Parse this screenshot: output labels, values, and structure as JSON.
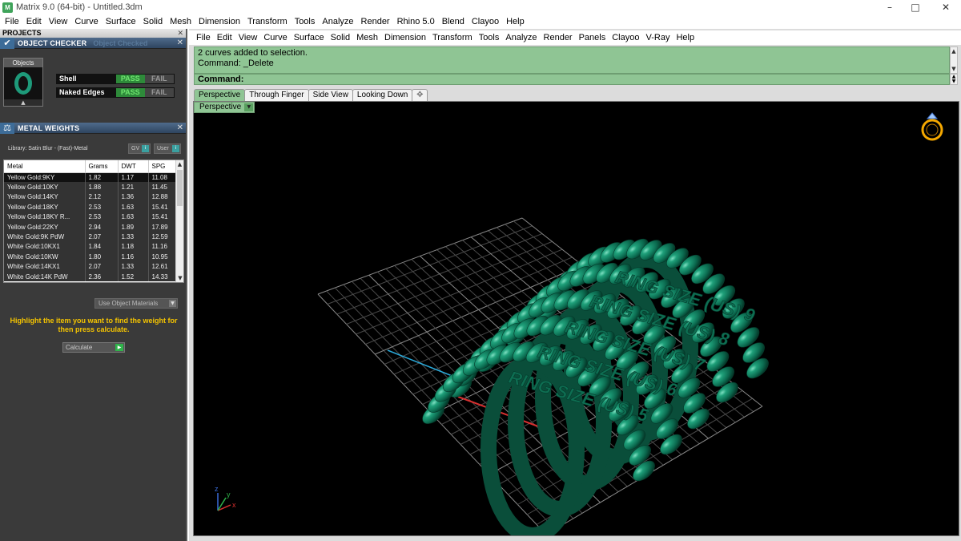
{
  "window": {
    "title": "Matrix 9.0 (64-bit) - Untitled.3dm",
    "minimize": "–",
    "maximize": "□",
    "close": "✕"
  },
  "main_menu": [
    "File",
    "Edit",
    "View",
    "Curve",
    "Surface",
    "Solid",
    "Mesh",
    "Dimension",
    "Transform",
    "Tools",
    "Analyze",
    "Render",
    "Rhino 5.0",
    "Blend",
    "Clayoo",
    "Help"
  ],
  "left_panel": {
    "projects_label": "PROJECTS",
    "object_checker": {
      "title": "OBJECT CHECKER",
      "status": "Object Checked",
      "objects_label": "Objects",
      "checks": [
        {
          "label": "Shell",
          "pass": "PASS",
          "fail": "FAIL"
        },
        {
          "label": "Naked Edges",
          "pass": "PASS",
          "fail": "FAIL"
        }
      ]
    },
    "metal_weights": {
      "title": "METAL WEIGHTS",
      "library": "Library: Satin Blur - (Fast)-Metal",
      "btn_gv": "GV",
      "btn_user": "User",
      "columns": [
        "Metal",
        "Grams",
        "DWT",
        "SPG"
      ],
      "rows": [
        [
          "Yellow Gold:9KY",
          "1.82",
          "1.17",
          "11.08"
        ],
        [
          "Yellow Gold:10KY",
          "1.88",
          "1.21",
          "11.45"
        ],
        [
          "Yellow Gold:14KY",
          "2.12",
          "1.36",
          "12.88"
        ],
        [
          "Yellow Gold:18KY",
          "2.53",
          "1.63",
          "15.41"
        ],
        [
          "Yellow Gold:18KY R...",
          "2.53",
          "1.63",
          "15.41"
        ],
        [
          "Yellow Gold:22KY",
          "2.94",
          "1.89",
          "17.89"
        ],
        [
          "White Gold:9K PdW",
          "2.07",
          "1.33",
          "12.59"
        ],
        [
          "White Gold:10KX1",
          "1.84",
          "1.18",
          "11.16"
        ],
        [
          "White Gold:10KW",
          "1.80",
          "1.16",
          "10.95"
        ],
        [
          "White Gold:14KX1",
          "2.07",
          "1.33",
          "12.61"
        ],
        [
          "White Gold:14K PdW",
          "2.36",
          "1.52",
          "14.33"
        ]
      ],
      "use_object_materials": "Use Object Materials",
      "hint": "Highlight the item you want to find the weight for then press calculate.",
      "calculate": "Calculate"
    }
  },
  "rhino": {
    "menu": [
      "File",
      "Edit",
      "View",
      "Curve",
      "Surface",
      "Solid",
      "Mesh",
      "Dimension",
      "Transform",
      "Tools",
      "Analyze",
      "Render",
      "Panels",
      "Clayoo",
      "V-Ray",
      "Help"
    ],
    "history_line1": "2 curves added to selection.",
    "history_line2": "Command: _Delete",
    "command_prompt": "Command:",
    "tabs": [
      "Perspective",
      "Through Finger",
      "Side View",
      "Looking Down"
    ],
    "active_tab": "Perspective",
    "viewport_label": "Perspective"
  },
  "scene": {
    "labels": [
      "RING SIZE (US)   9",
      "RING SIZE (US)   8",
      "RING SIZE (US)   7",
      "RING SIZE (US)   6",
      "RING SIZE (US)   5"
    ],
    "axis_x": "x",
    "axis_y": "y",
    "axis_z": "z"
  },
  "colors": {
    "command_green": "#8fc594",
    "ring_green": "#0f7a5c",
    "label_green": "#0e6e52",
    "grid": "#6a6a6a",
    "hint_yellow": "#f5c400",
    "pass_green": "#2e8a3a"
  }
}
